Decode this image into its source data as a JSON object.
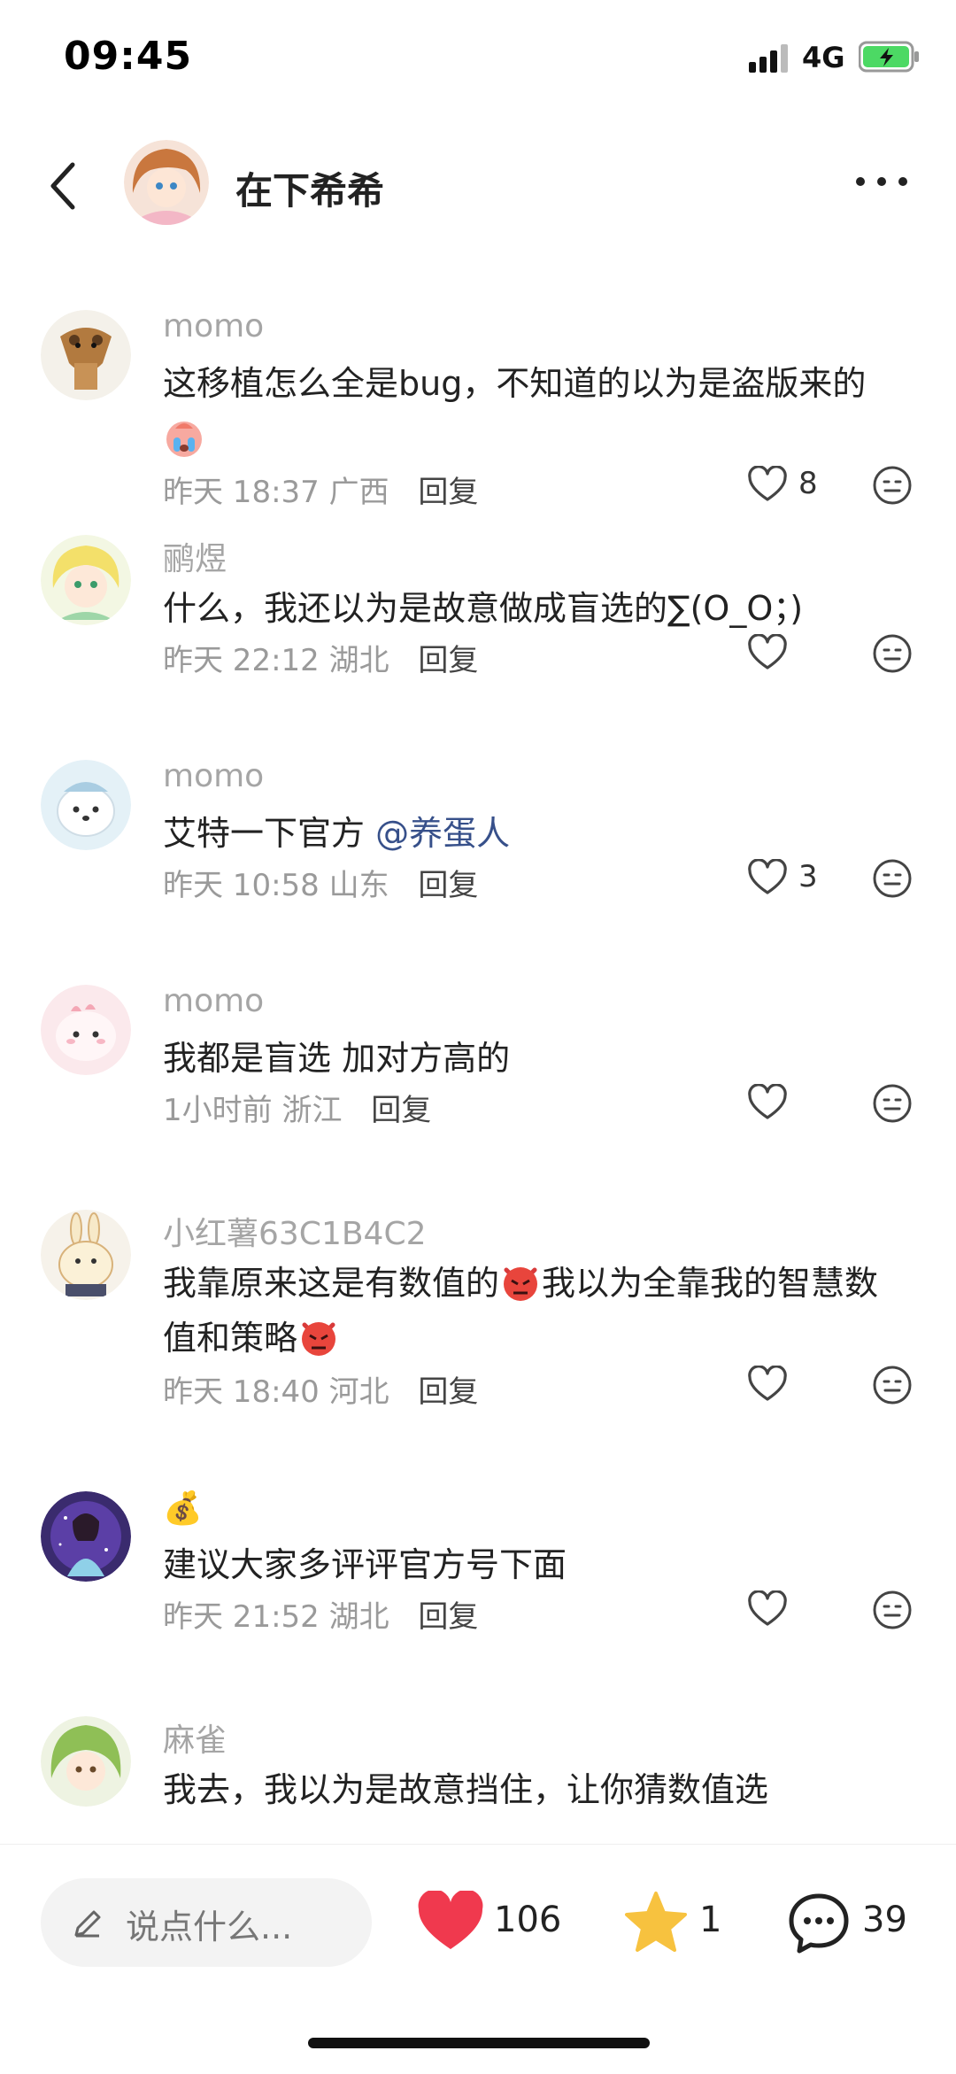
{
  "status": {
    "time": "09:45",
    "network": "4G"
  },
  "header": {
    "title": "在下希希"
  },
  "comments": [
    {
      "name": "momo",
      "text": "这移植怎么全是bug，不知道的以为是盗版来的",
      "time": "昨天 18:37",
      "location": "广西",
      "reply": "回复",
      "likes": "8"
    },
    {
      "name": "鹂煜",
      "text": "什么，我还以为是故意做成盲选的∑(O_O；)",
      "time": "昨天 22:12",
      "location": "湖北",
      "reply": "回复",
      "likes": ""
    },
    {
      "name": "momo",
      "text": "艾特一下官方",
      "mention": "@养蛋人",
      "time": "昨天 10:58",
      "location": "山东",
      "reply": "回复",
      "likes": "3"
    },
    {
      "name": "momo",
      "text": "我都是盲选 加对方高的",
      "time": "1小时前",
      "location": "浙江",
      "reply": "回复",
      "likes": ""
    },
    {
      "name": "小红薯63C1B4C2",
      "text_a": "我靠原来这是有数值的",
      "text_b": "我以为全靠我的智慧数值和策略",
      "time": "昨天 18:40",
      "location": "河北",
      "reply": "回复",
      "likes": ""
    },
    {
      "name": "💰",
      "text": "建议大家多评评官方号下面",
      "time": "昨天 21:52",
      "location": "湖北",
      "reply": "回复",
      "likes": ""
    },
    {
      "name": "麻雀",
      "text": "我去，我以为是故意挡住，让你猜数值选",
      "time": "",
      "location": "",
      "reply": "",
      "likes": ""
    }
  ],
  "bottom": {
    "input_placeholder": "说点什么...",
    "likes": "106",
    "stars": "1",
    "comments": "39"
  },
  "colors": {
    "like_red": "#f0394e",
    "star_yellow": "#f7c23f",
    "mention_blue": "#37508a"
  }
}
